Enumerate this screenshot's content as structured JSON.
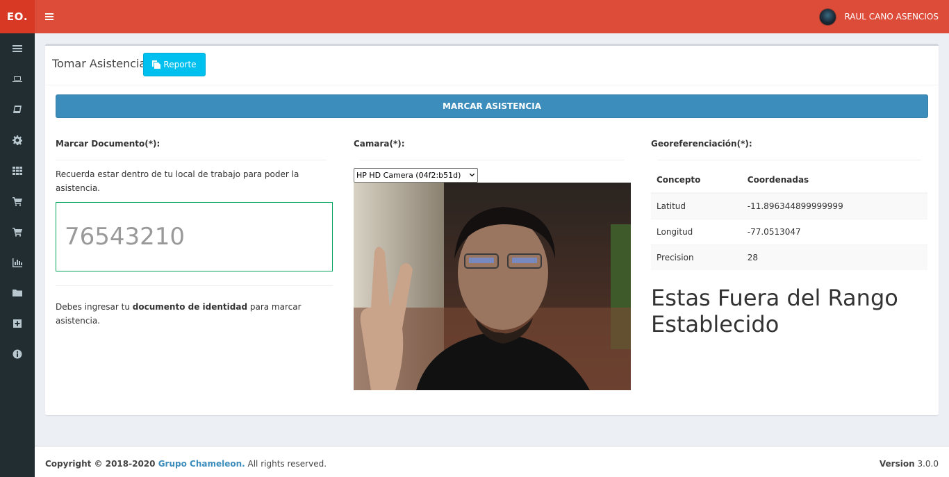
{
  "app": {
    "logo_main": "EO",
    "logo_dot": ".",
    "user_name": "RAUL CANO ASENCIOS"
  },
  "sidebar": {
    "icons": [
      "list-icon",
      "laptop-icon",
      "book-icon",
      "gear-icon",
      "grid-icon",
      "cart-icon",
      "cart-icon",
      "bar-chart-icon",
      "folder-icon",
      "plus-square-icon",
      "info-icon"
    ]
  },
  "header": {
    "title": "Tomar Asistencia",
    "report_label": "Reporte"
  },
  "main": {
    "mark_label": "MARCAR ASISTENCIA",
    "document": {
      "label": "Marcar Documento(*):",
      "note": "Recuerda estar dentro de tu local de trabajo para poder la asistencia.",
      "value": "76543210",
      "footer_prefix": "Debes ingresar tu ",
      "footer_bold": "documento de identidad",
      "footer_suffix": " para marcar asistencia."
    },
    "camera": {
      "label": "Camara(*):",
      "selected": "HP HD Camera (04f2:b51d)"
    },
    "geo": {
      "label": "Georeferenciación(*):",
      "headers": [
        "Concepto",
        "Coordenadas"
      ],
      "rows": [
        [
          "Latitud",
          "-11.896344899999999"
        ],
        [
          "Longitud",
          "-77.0513047"
        ],
        [
          "Precision",
          "28"
        ]
      ],
      "message": "Estas Fuera del Rango Establecido"
    }
  },
  "footer": {
    "copyright": "Copyright © 2018-2020 ",
    "company": "Grupo Chameleon.",
    "rights": " All rights reserved.",
    "version_label": "Version",
    "version_value": " 3.0.0"
  },
  "colors": {
    "topbar": "#dd4b39",
    "sidebar": "#222d32",
    "primary": "#3c8dbc",
    "info": "#00c0ef",
    "success": "#00a65a"
  }
}
